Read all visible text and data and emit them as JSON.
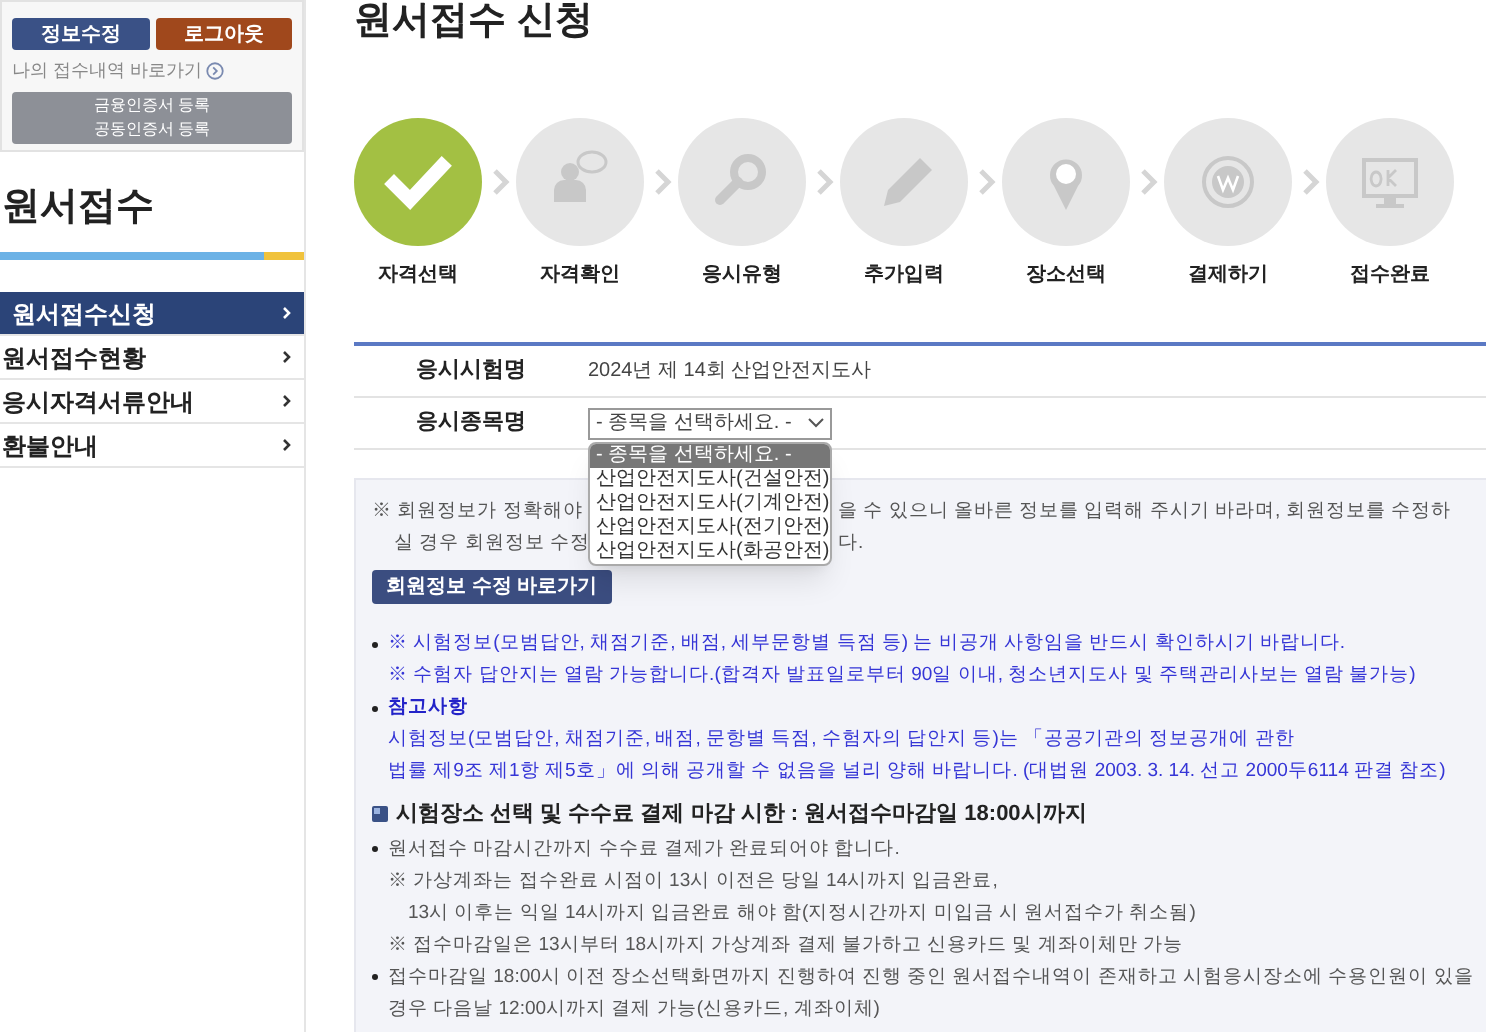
{
  "sidebar": {
    "buttons": [
      {
        "kind": "edit",
        "label": "정보수정"
      },
      {
        "kind": "logout",
        "label": "로그아웃"
      }
    ],
    "history_link": "나의 접수내역 바로가기",
    "cert_button": [
      "금융인증서 등록",
      "공동인증서 등록"
    ],
    "heading": "원서접수",
    "menu": [
      {
        "label": "원서접수신청",
        "selected": true
      },
      {
        "label": "원서접수현황",
        "selected": false
      },
      {
        "label": "응시자격서류안내",
        "selected": false
      },
      {
        "label": "환불안내",
        "selected": false
      }
    ]
  },
  "page_title": "원서접수 신청",
  "steps": [
    {
      "kind": "check",
      "label": "자격선택",
      "selected": true
    },
    {
      "kind": "person",
      "label": "자격확인",
      "selected": false
    },
    {
      "kind": "search",
      "label": "응시유형",
      "selected": false
    },
    {
      "kind": "pencil",
      "label": "추가입력",
      "selected": false
    },
    {
      "kind": "pin",
      "label": "장소선택",
      "selected": false
    },
    {
      "kind": "coin",
      "label": "결제하기",
      "selected": false
    },
    {
      "kind": "monitor",
      "label": "접수완료",
      "selected": false
    }
  ],
  "form": {
    "exam_label": "응시시험명",
    "exam_value": "2024년 제 14회 산업안전지도사",
    "subject_label": "응시종목명",
    "subject_value": "- 종목을 선택하세요. -",
    "options": [
      {
        "label": "- 종목을 선택하세요. -",
        "selected": true
      },
      {
        "label": "산업안전지도사(건설안전)",
        "selected": false
      },
      {
        "label": "산업안전지도사(기계안전)",
        "selected": false
      },
      {
        "label": "산업안전지도사(전기안전)",
        "selected": false
      },
      {
        "label": "산업안전지도사(화공안전)",
        "selected": false
      }
    ]
  },
  "notice": {
    "member_lines": [
      {
        "left": "※ 회원정보가 정확해야",
        "right": "을 수 있으니 올바른 정보를 입력해 주시기 바라며, 회원정보를 수정하"
      },
      {
        "left": "실 경우 회원정보 수정",
        "right": "다."
      }
    ],
    "member_button": "회원정보 수정 바로가기",
    "info_items": [
      {
        "kind": "text",
        "lines": [
          "※ 시험정보(모범답안, 채점기준, 배점, 세부문항별 득점 등) 는 비공개 사항임을 반드시 확인하시기 바랍니다.",
          "※ 수험자 답안지는 열람 가능합니다.(합격자 발표일로부터 90일 이내, 청소년지도사 및 주택관리사보는 열람 불가능)"
        ]
      },
      {
        "kind": "title",
        "lines": [
          "참고사항",
          "시험정보(모범답안, 채점기준, 배점, 문항별 득점, 수험자의 답안지 등)는 「공공기관의 정보공개에 관한",
          "법률 제9조 제1항 제5호」에 의해 공개할 수 없음을 널리 양해 바랍니다. (대법원 2003. 3. 14. 선고 2000두6114 판결 참조)"
        ]
      }
    ],
    "deadline_title": "시험장소 선택 및 수수료 결제 마감 시한 : 원서접수마감일 18:00시까지",
    "deadline_items": [
      {
        "lines": [
          "원서접수 마감시간까지 수수료 결제가 완료되어야 합니다.",
          "※ 가상계좌는 접수완료 시점이 13시 이전은 당일 14시까지 입금완료,",
          "13시 이후는 익일 14시까지 입금완료 해야 함(지정시간까지 미입금 시 원서접수가 취소됨)",
          "※ 접수마감일은 13시부터 18시까지 가상계좌 결제 불가하고 신용카드 및 계좌이체만 가능"
        ]
      },
      {
        "lines": [
          "접수마감일 18:00시 이전 장소선택화면까지 진행하여 진행 중인 원서접수내역이 존재하고 시험응시장소에 수용인원이 있을",
          "경우 다음날 12:00시까지 결제 가능(신용카드, 계좌이체)"
        ]
      }
    ]
  }
}
